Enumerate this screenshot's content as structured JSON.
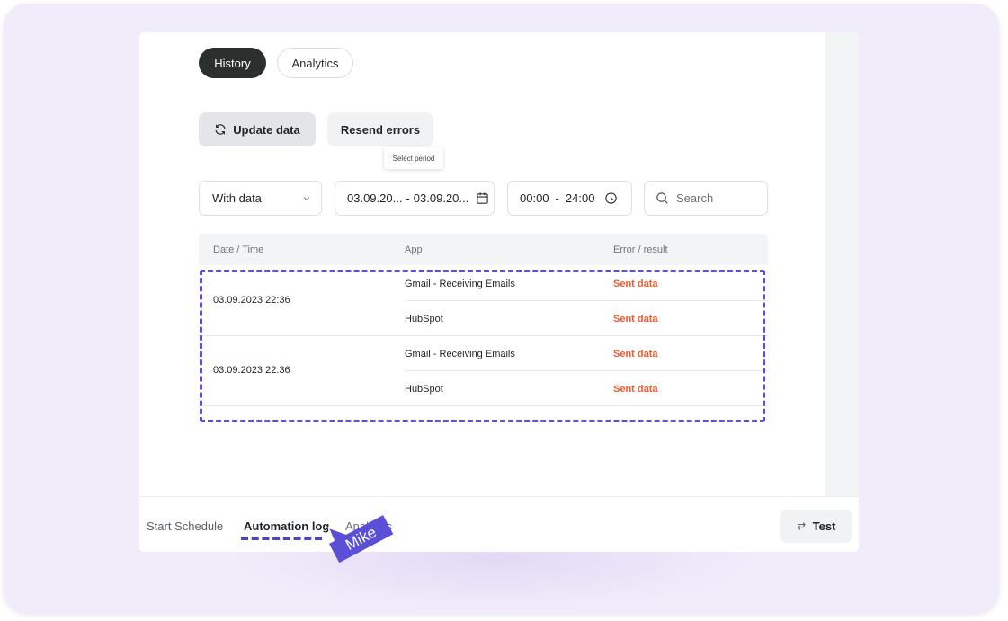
{
  "tabs": {
    "history": "History",
    "analytics": "Analytics"
  },
  "actions": {
    "update": "Update data",
    "resend": "Resend errors",
    "tooltip": "Select period"
  },
  "filters": {
    "mode": "With data",
    "date_from": "03.09.20...",
    "date_sep": "-",
    "date_to": "03.09.20...",
    "time_from": "00:00",
    "time_sep": "-",
    "time_to": "24:00",
    "search_placeholder": "Search"
  },
  "table": {
    "headers": [
      "Date / Time",
      "App",
      "Error / result"
    ],
    "groups": [
      {
        "datetime": "03.09.2023 22:36",
        "rows": [
          {
            "app": "Gmail - Receiving Emails",
            "result": "Sent data"
          },
          {
            "app": "HubSpot",
            "result": "Sent data"
          }
        ]
      },
      {
        "datetime": "03.09.2023 22:36",
        "rows": [
          {
            "app": "Gmail - Receiving Emails",
            "result": "Sent data"
          },
          {
            "app": "HubSpot",
            "result": "Sent data"
          }
        ]
      }
    ]
  },
  "bottom_tabs": {
    "schedule": "Start Schedule",
    "log": "Automation log",
    "analytics": "Analytics"
  },
  "test_button": "Test",
  "cursor_label": "Mike",
  "colors": {
    "accent": "#5a4fd6",
    "result": "#ef5b2c",
    "dark_pill": "#2b2f2d",
    "background": "#f1ecfa"
  },
  "icons": [
    "refresh-icon",
    "chevron-down-icon",
    "calendar-icon",
    "clock-icon",
    "search-icon",
    "swap-icon",
    "cursor-pointer-icon"
  ]
}
